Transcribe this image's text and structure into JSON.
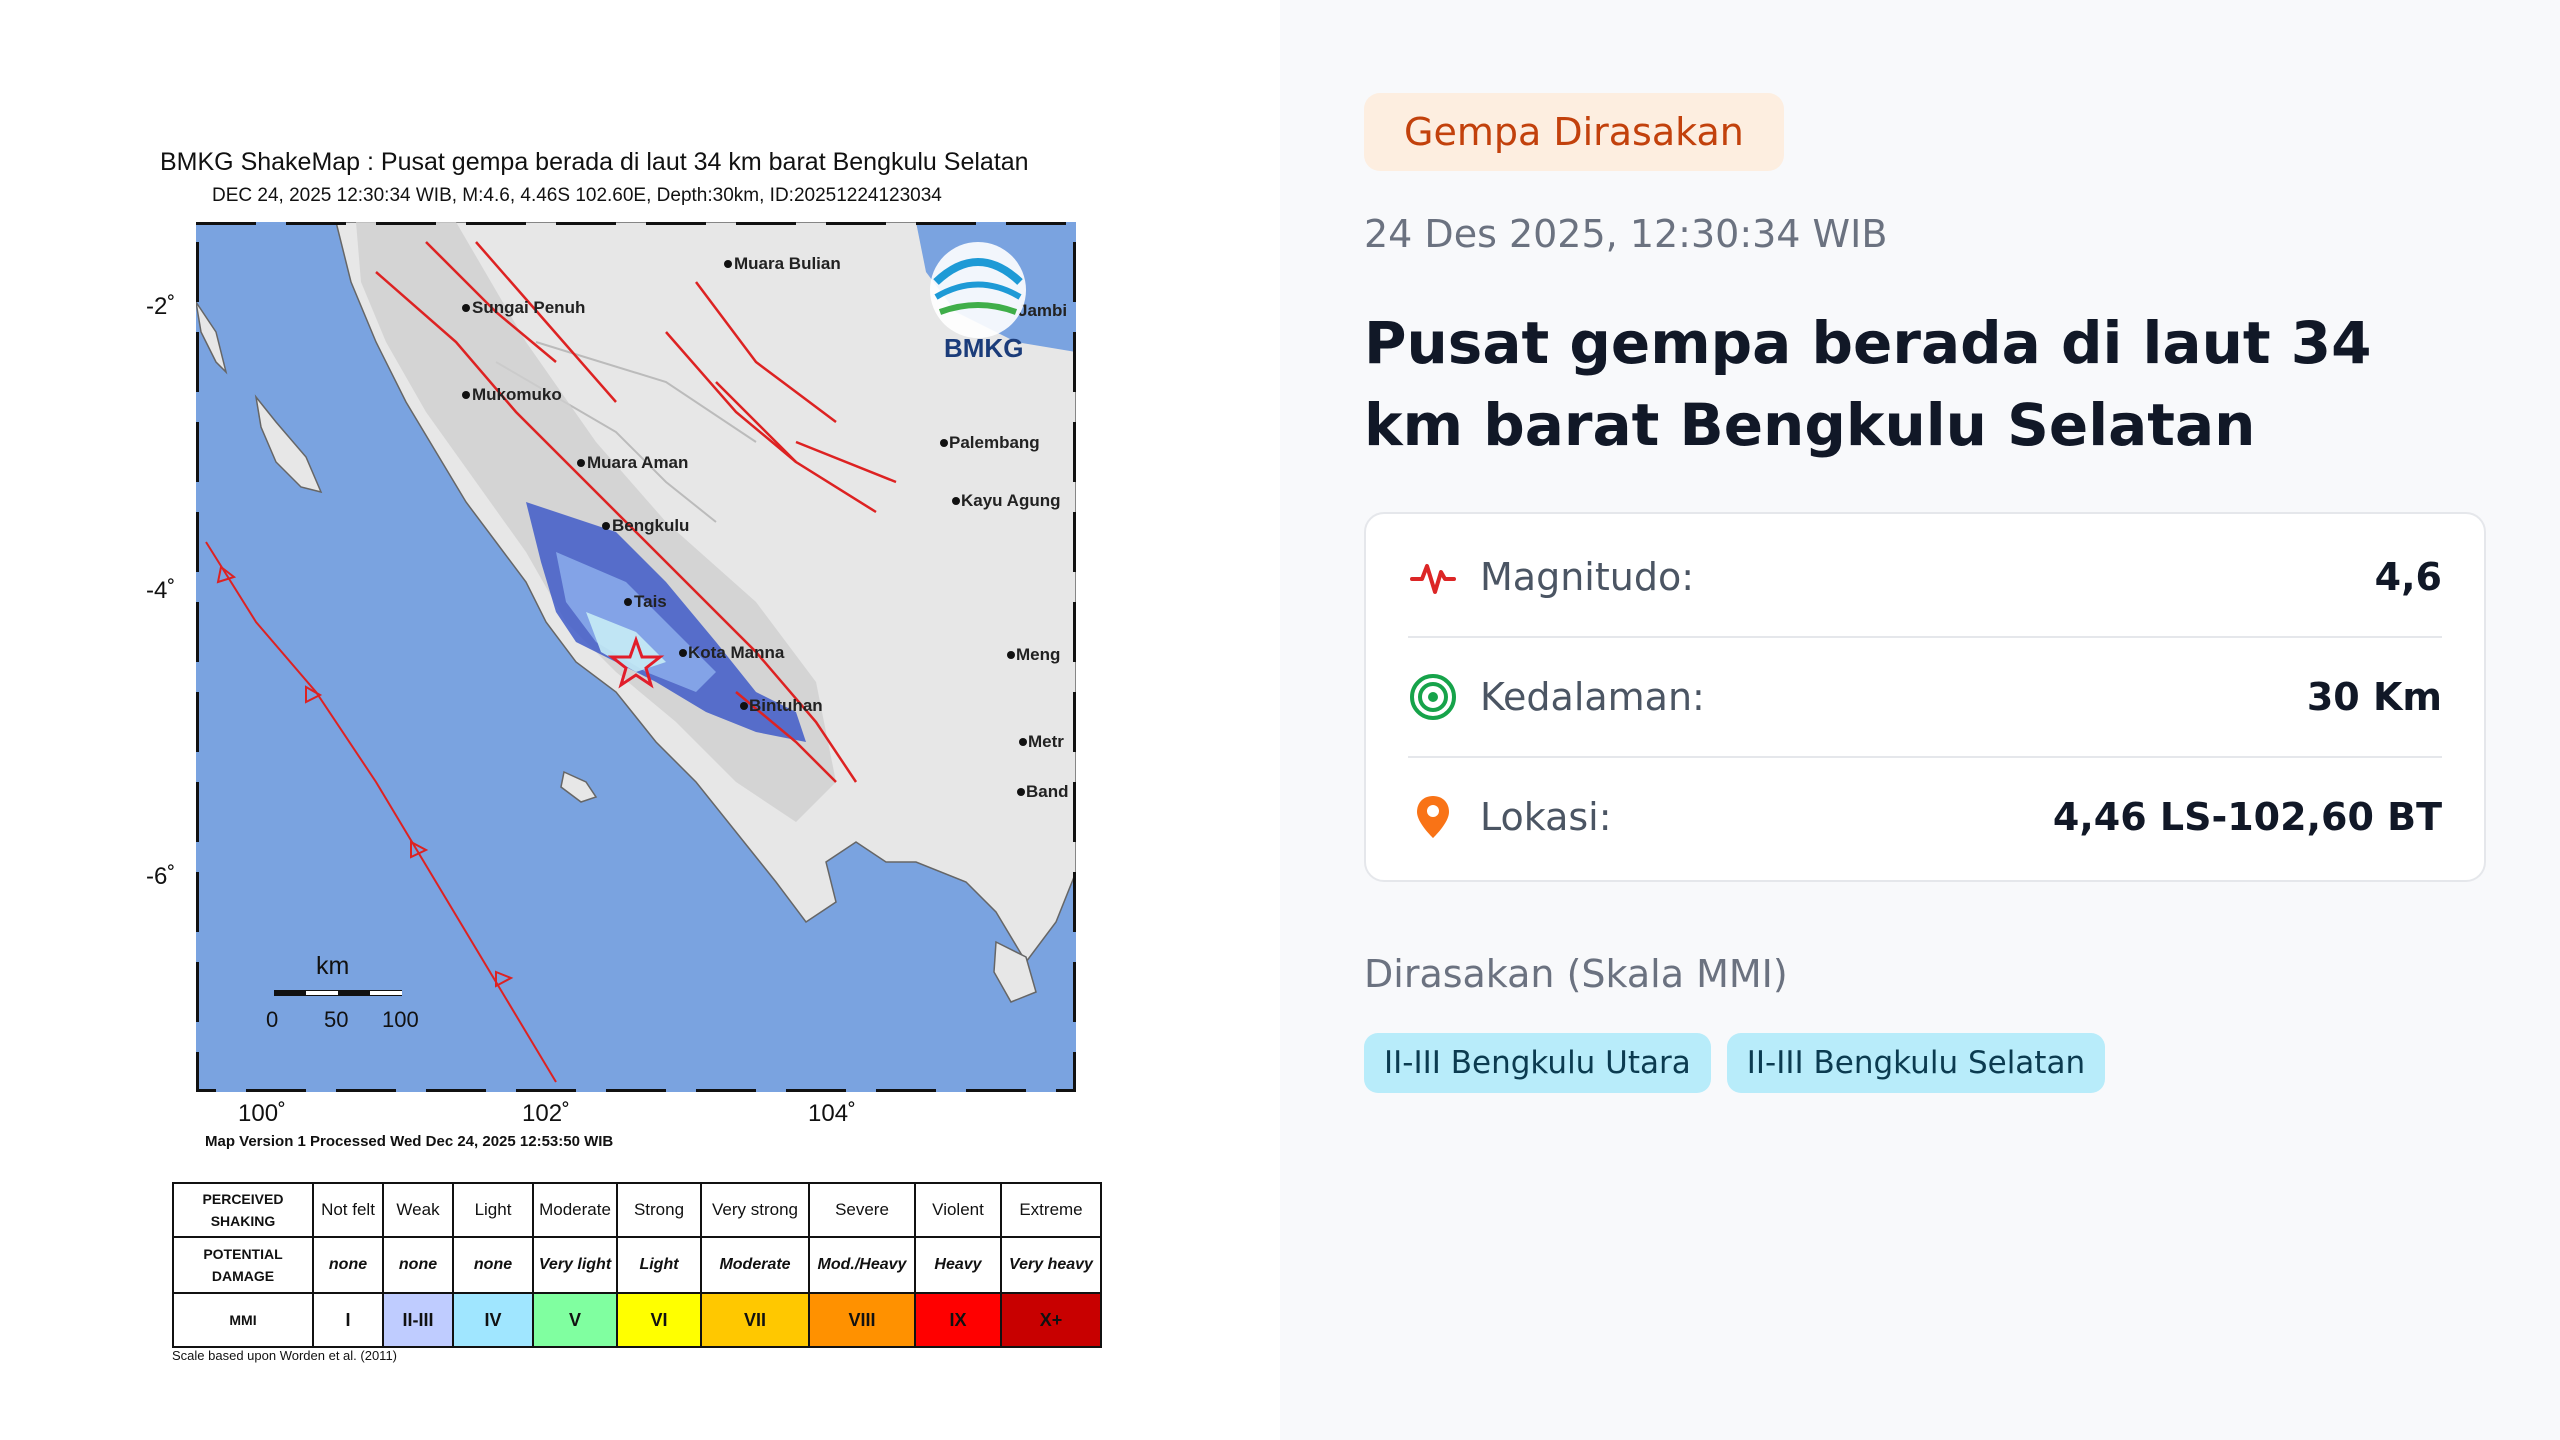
{
  "badge": "Gempa Dirasakan",
  "datetime": "24 Des 2025, 12:30:34 WIB",
  "headline": "Pusat gempa berada di laut 34 km barat Bengkulu Selatan",
  "details": {
    "magnitude_label": "Magnitudo:",
    "magnitude_value": "4,6",
    "depth_label": "Kedalaman:",
    "depth_value": "30 Km",
    "location_label": "Lokasi:",
    "location_value": "4,46 LS-102,60 BT"
  },
  "felt": {
    "title": "Dirasakan (Skala MMI)",
    "chips": [
      "II-III Bengkulu Utara",
      "II-III Bengkulu Selatan"
    ]
  },
  "shakemap": {
    "title": "BMKG ShakeMap : Pusat gempa berada di laut 34 km barat Bengkulu Selatan",
    "subtitle": "DEC 24, 2025 12:30:34 WIB, M:4.6, 4.46S 102.60E, Depth:30km, ID:20251224123034",
    "lat_labels": [
      "-2˚",
      "-4˚",
      "-6˚"
    ],
    "lon_labels": [
      "100˚",
      "102˚",
      "104˚"
    ],
    "cities": [
      "Muara Bulian",
      "Sungai Penuh",
      "Mukomuko",
      "Palembang",
      "Muara Aman",
      "Kayu Agung",
      "Bengkulu",
      "Tais",
      "Kota Manna",
      "Meng",
      "Bintuhan",
      "Metr",
      "Band",
      "Jambi"
    ],
    "logo_text": "BMKG",
    "scale_title": "km",
    "scale_ticks": [
      "0",
      "50",
      "100"
    ],
    "version": "Map Version 1 Processed Wed Dec 24, 2025 12:53:50 WIB",
    "legend": {
      "row_perceived": "PERCEIVED SHAKING",
      "row_damage": "POTENTIAL DAMAGE",
      "row_mmi": "MMI",
      "perceived": [
        "Not felt",
        "Weak",
        "Light",
        "Moderate",
        "Strong",
        "Very strong",
        "Severe",
        "Violent",
        "Extreme"
      ],
      "damage": [
        "none",
        "none",
        "none",
        "Very light",
        "Light",
        "Moderate",
        "Mod./Heavy",
        "Heavy",
        "Very heavy"
      ],
      "mmi": [
        "I",
        "II-III",
        "IV",
        "V",
        "VI",
        "VII",
        "VIII",
        "IX",
        "X+"
      ],
      "colors": [
        "#ffffff",
        "#bfccff",
        "#a0e6ff",
        "#80ffa0",
        "#ffff00",
        "#ffc800",
        "#ff9100",
        "#ff0000",
        "#c80000"
      ]
    },
    "scale_note": "Scale based upon Worden et al. (2011)"
  }
}
